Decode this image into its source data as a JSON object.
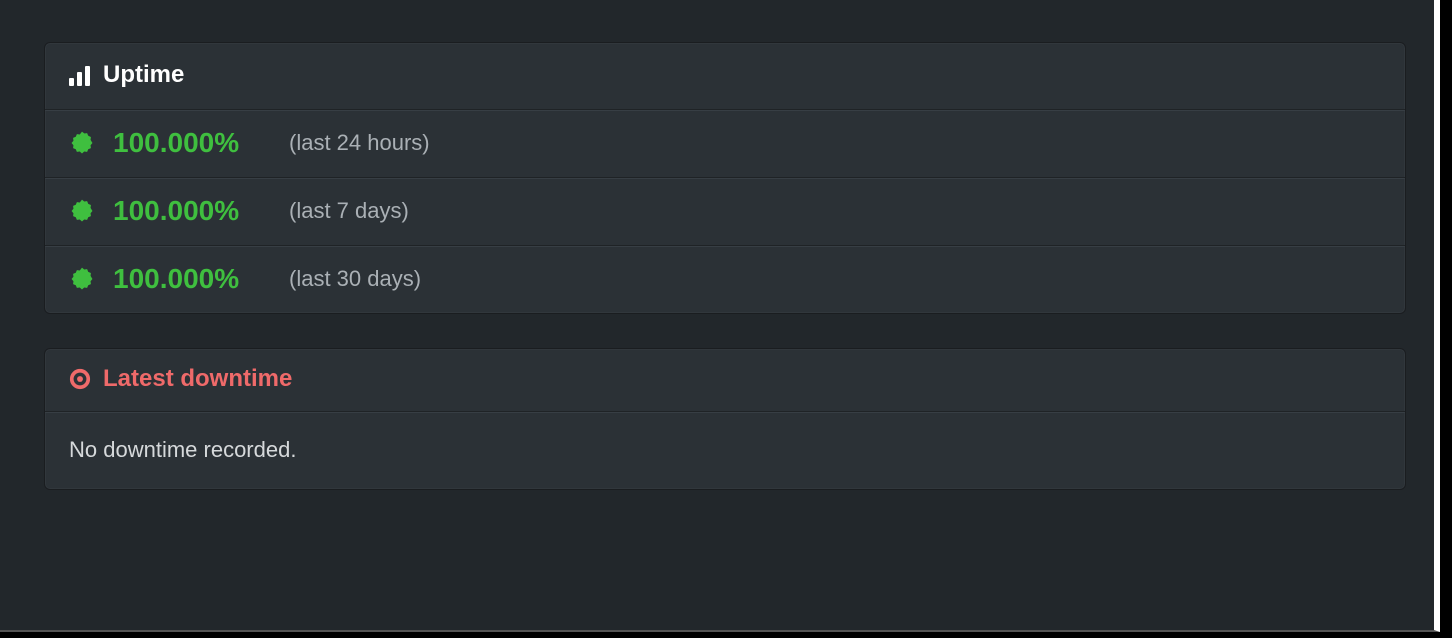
{
  "colors": {
    "green": "#3fbf3f",
    "red": "#ef6a6a",
    "panel_bg": "#2b3136",
    "page_bg": "#22272b"
  },
  "uptime": {
    "title": "Uptime",
    "rows": [
      {
        "value": "100.000%",
        "period": "(last 24 hours)"
      },
      {
        "value": "100.000%",
        "period": "(last 7 days)"
      },
      {
        "value": "100.000%",
        "period": "(last 30 days)"
      }
    ]
  },
  "downtime": {
    "title": "Latest downtime",
    "body": "No downtime recorded."
  }
}
